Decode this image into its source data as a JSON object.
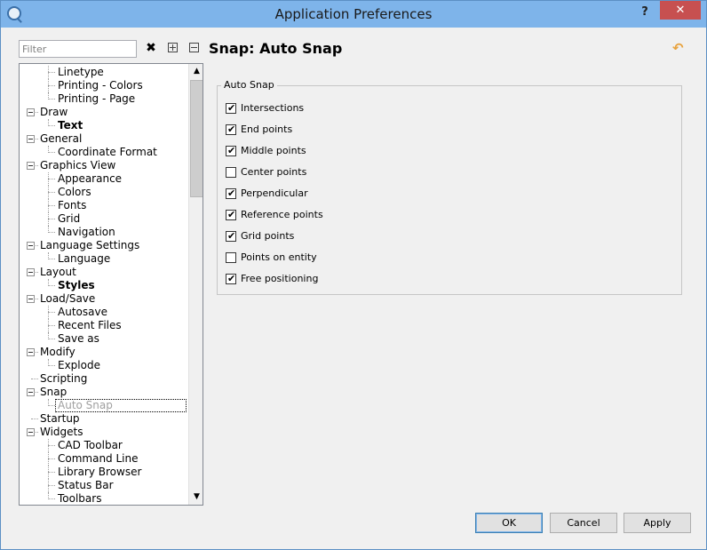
{
  "window": {
    "title": "Application Preferences",
    "help": "?",
    "close": "✕"
  },
  "filter": {
    "placeholder": "Filter",
    "value": ""
  },
  "toolbar": {
    "clear": "✖"
  },
  "tree": {
    "items": [
      {
        "label": "Linetype",
        "level": 1
      },
      {
        "label": "Printing - Colors",
        "level": 1
      },
      {
        "label": "Printing - Page",
        "level": 1
      },
      {
        "label": "Draw",
        "level": 0,
        "expanded": true
      },
      {
        "label": "Text",
        "level": 1,
        "bold": true
      },
      {
        "label": "General",
        "level": 0,
        "expanded": true
      },
      {
        "label": "Coordinate Format",
        "level": 1
      },
      {
        "label": "Graphics View",
        "level": 0,
        "expanded": true
      },
      {
        "label": "Appearance",
        "level": 1
      },
      {
        "label": "Colors",
        "level": 1
      },
      {
        "label": "Fonts",
        "level": 1
      },
      {
        "label": "Grid",
        "level": 1
      },
      {
        "label": "Navigation",
        "level": 1
      },
      {
        "label": "Language Settings",
        "level": 0,
        "expanded": true
      },
      {
        "label": "Language",
        "level": 1
      },
      {
        "label": "Layout",
        "level": 0,
        "expanded": true
      },
      {
        "label": "Styles",
        "level": 1,
        "bold": true
      },
      {
        "label": "Load/Save",
        "level": 0,
        "expanded": true
      },
      {
        "label": "Autosave",
        "level": 1
      },
      {
        "label": "Recent Files",
        "level": 1
      },
      {
        "label": "Save as",
        "level": 1
      },
      {
        "label": "Modify",
        "level": 0,
        "expanded": true
      },
      {
        "label": "Explode",
        "level": 1
      },
      {
        "label": "Scripting",
        "level": 0
      },
      {
        "label": "Snap",
        "level": 0,
        "expanded": true
      },
      {
        "label": "Auto Snap",
        "level": 1,
        "selected": true
      },
      {
        "label": "Startup",
        "level": 0
      },
      {
        "label": "Widgets",
        "level": 0,
        "expanded": true
      },
      {
        "label": "CAD Toolbar",
        "level": 1
      },
      {
        "label": "Command Line",
        "level": 1
      },
      {
        "label": "Library Browser",
        "level": 1
      },
      {
        "label": "Status Bar",
        "level": 1
      },
      {
        "label": "Toolbars",
        "level": 1
      }
    ]
  },
  "page": {
    "title": "Snap: Auto Snap",
    "reset_icon": "↶"
  },
  "group": {
    "legend": "Auto Snap",
    "options": [
      {
        "label": "Intersections",
        "checked": true
      },
      {
        "label": "End points",
        "checked": true
      },
      {
        "label": "Middle points",
        "checked": true
      },
      {
        "label": "Center points",
        "checked": false
      },
      {
        "label": "Perpendicular",
        "checked": true
      },
      {
        "label": "Reference points",
        "checked": true
      },
      {
        "label": "Grid points",
        "checked": true
      },
      {
        "label": "Points on entity",
        "checked": false
      },
      {
        "label": "Free positioning",
        "checked": true
      }
    ]
  },
  "buttons": {
    "ok": "OK",
    "cancel": "Cancel",
    "apply": "Apply"
  }
}
